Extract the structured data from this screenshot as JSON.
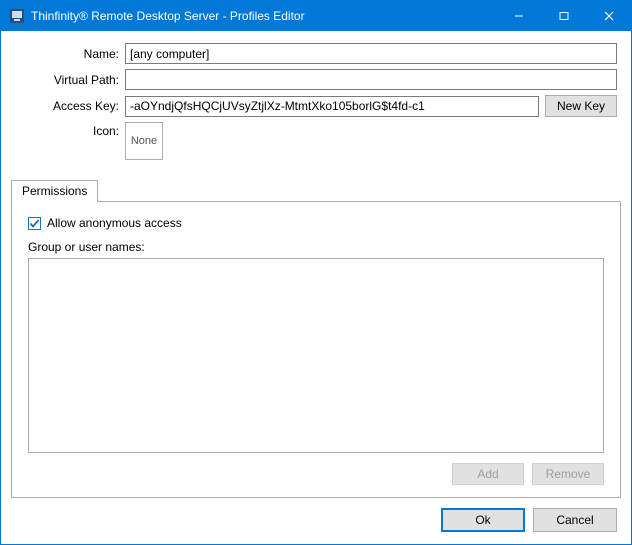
{
  "titlebar": {
    "title": "Thinfinity® Remote Desktop Server - Profiles Editor"
  },
  "form": {
    "name_label": "Name:",
    "name_value": "[any computer]",
    "vpath_label": "Virtual Path:",
    "vpath_value": "",
    "accesskey_label": "Access Key:",
    "accesskey_value": "-aOYndjQfsHQCjUVsyZtjlXz-MtmtXko105borlG$t4fd-c1",
    "newkey_btn": "New Key",
    "icon_label": "Icon:",
    "icon_value": "None"
  },
  "tabs": {
    "permissions_label": "Permissions"
  },
  "permissions": {
    "anon_label": "Allow anonymous access",
    "anon_checked": true,
    "group_label": "Group or user names:",
    "add_btn": "Add",
    "remove_btn": "Remove"
  },
  "footer": {
    "ok": "Ok",
    "cancel": "Cancel"
  }
}
